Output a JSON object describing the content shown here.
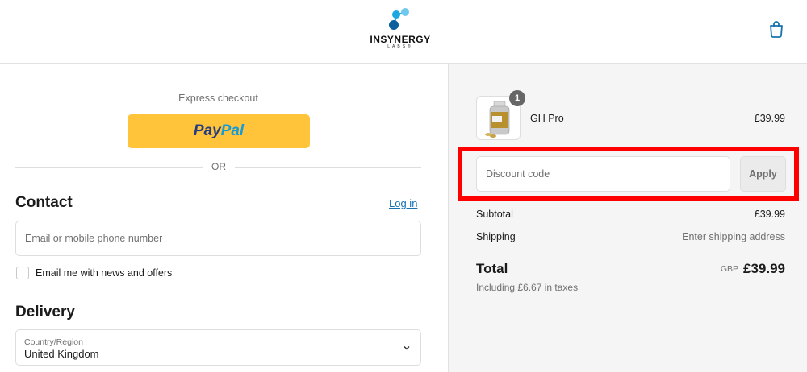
{
  "brand": {
    "name": "INSYNERGY",
    "sub": "LABS®",
    "colors": {
      "accent": "#1773b0",
      "logo_blue": "#1da7e0",
      "paypal_yellow": "#ffc439",
      "highlight": "#ff0000"
    }
  },
  "header": {
    "cart_icon": "shopping-bag-icon"
  },
  "express": {
    "label": "Express checkout",
    "paypal_part1": "Pay",
    "paypal_part2": "Pal",
    "or_text": "OR"
  },
  "contact": {
    "title": "Contact",
    "login_link": "Log in",
    "email_placeholder": "Email or mobile phone number",
    "newsletter_label": "Email me with news and offers"
  },
  "delivery": {
    "title": "Delivery",
    "country_label": "Country/Region",
    "country_value": "United Kingdom"
  },
  "order": {
    "item": {
      "name": "GH Pro",
      "price": "£39.99",
      "quantity": "1"
    },
    "discount_placeholder": "Discount code",
    "apply_label": "Apply",
    "subtotal_label": "Subtotal",
    "subtotal_value": "£39.99",
    "shipping_label": "Shipping",
    "shipping_value": "Enter shipping address",
    "total_label": "Total",
    "total_currency": "GBP",
    "total_value": "£39.99",
    "tax_note": "Including £6.67 in taxes"
  }
}
